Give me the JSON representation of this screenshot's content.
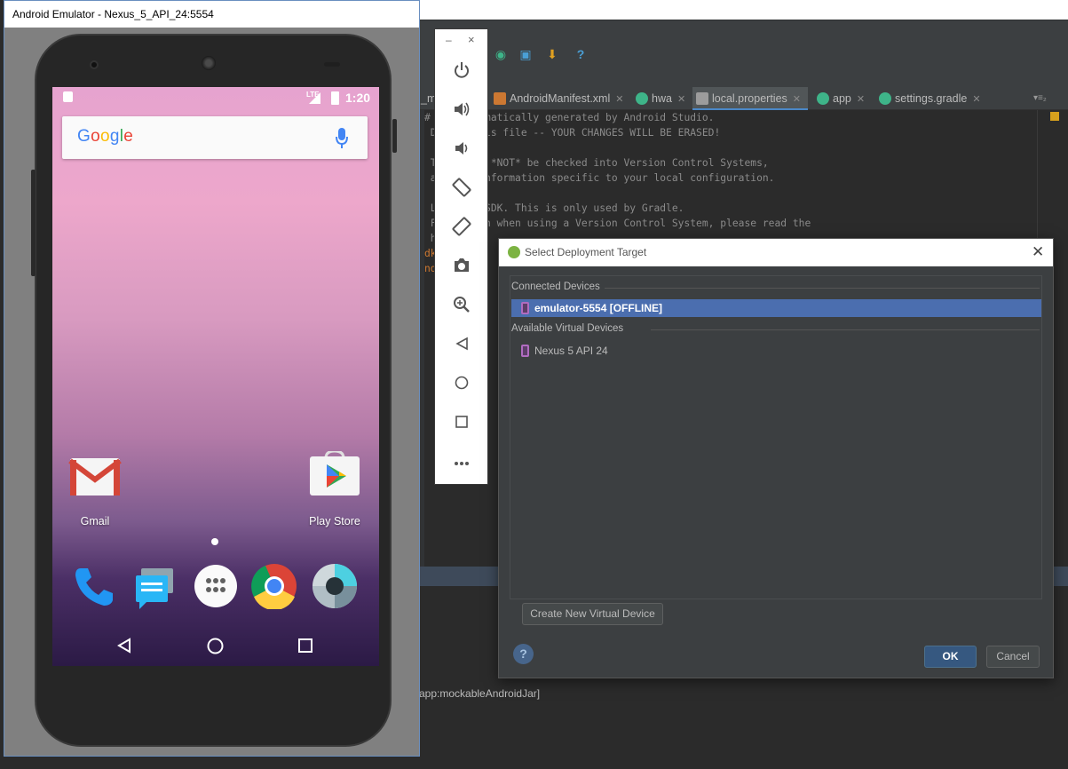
{
  "emulator": {
    "title": "Android Emulator - Nexus_5_API_24:5554",
    "status_bar": {
      "time": "1:20",
      "network": "LTE"
    },
    "search": {
      "brand_letters": [
        "G",
        "o",
        "o",
        "g",
        "l",
        "e"
      ]
    },
    "apps": [
      {
        "label": "Gmail"
      },
      {
        "label": "Play Store"
      }
    ],
    "dock": [
      "phone",
      "messages",
      "apps",
      "chrome",
      "camera"
    ],
    "navbar": [
      "back",
      "home",
      "recents"
    ]
  },
  "emulator_toolbar": {
    "minimize": "–",
    "close": "×",
    "buttons": [
      "power",
      "volume-up",
      "volume-down",
      "rotate-left",
      "rotate-right",
      "screenshot",
      "zoom",
      "back",
      "home",
      "overview",
      "more"
    ]
  },
  "ide": {
    "tabs": [
      {
        "label": "_ma",
        "icon_color": "#6a8759"
      },
      {
        "label": "AndroidManifest.xml",
        "icon_color": "#cc7832"
      },
      {
        "label": "hwa",
        "icon_color": "#3eb489"
      },
      {
        "label": "local.properties",
        "icon_color": "#9c9c9c"
      },
      {
        "label": "app",
        "icon_color": "#3eb489"
      },
      {
        "label": "settings.gradle",
        "icon_color": "#3eb489"
      }
    ],
    "code": [
      "#  is automatically generated by Android Studio.",
      " D  ify this file -- YOUR CHANGES WILL BE ERASED!",
      "",
      " T  should *NOT* be checked into Version Control Systems,",
      " a  ains information specific to your local configuration.",
      "",
      " L  f the SDK. This is only used by Gradle.",
      " F  ization when using a Version Control System, please read the",
      " h  e",
      "dk  \\",
      "nd  le"
    ],
    "console_line": "app:mockableAndroidJar]",
    "tab_menu": "▾≡₂"
  },
  "dialog": {
    "title": "Select Deployment Target",
    "connected_header": "Connected Devices",
    "connected_devices": [
      {
        "label": "emulator-5554 [OFFLINE]",
        "selected": true
      }
    ],
    "available_header": "Available Virtual Devices",
    "available_devices": [
      {
        "label": "Nexus 5 API 24"
      }
    ],
    "create_button": "Create New Virtual Device",
    "ok_button": "OK",
    "cancel_button": "Cancel",
    "help": "?",
    "close": "✕"
  },
  "colors": {
    "ide_bg": "#2b2b2b",
    "selection": "#4b6eaf",
    "ok_button": "#365880"
  }
}
